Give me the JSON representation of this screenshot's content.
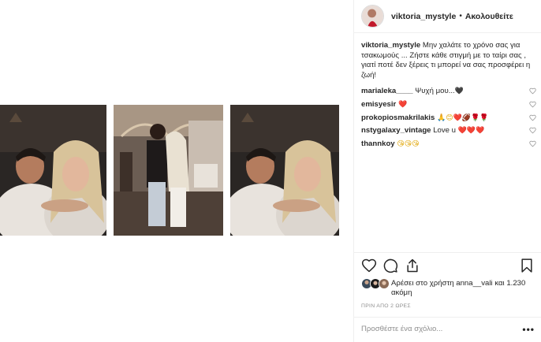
{
  "post": {
    "username": "viktoria_mystyle",
    "separator": "•",
    "follow_label": "Ακολουθείτε"
  },
  "caption": {
    "username": "viktoria_mystyle",
    "text": " Μην χαλάτε το χρόνο σας για τσακωμούς ... Ζήστε κάθε στιγμή με το ταίρι σας , γιατί ποτέ δεν ξέρεις τι μπορεί να σας προσφέρει η ζωή!"
  },
  "comments": [
    {
      "username": "marialeka____",
      "text": " Ψυχή μου...",
      "emoji": [
        "🖤"
      ]
    },
    {
      "username": "emisyesir",
      "text": " ",
      "emoji": [
        "❤️"
      ]
    },
    {
      "username": "prokopiosmakrilakis",
      "text": " ",
      "emoji": [
        "🙏",
        "😊",
        "❤️",
        "🏈",
        "🌹",
        "🌹"
      ]
    },
    {
      "username": "nstygalaxy_vintage",
      "text": " Love u ",
      "emoji": [
        "❤️",
        "❤️",
        "❤️"
      ]
    },
    {
      "username": "thannkoy",
      "text": " ",
      "emoji": [
        "😘",
        "😘",
        "😘"
      ]
    }
  ],
  "icons": {
    "like": "heart-outline-icon",
    "comment": "speech-bubble-icon",
    "share": "share-icon",
    "save": "bookmark-icon",
    "comment_like": "small-heart-icon",
    "more": "more-options-icon"
  },
  "likes": {
    "text": "Αρέσει στο χρήστη anna__vali και 1.230 ακόμη"
  },
  "timestamp": "ΠΡΙΝ ΑΠΟ 2 ΩΡΕΣ",
  "add_comment": {
    "placeholder": "Προσθέστε ένα σχόλιο...",
    "more_label": "•••"
  },
  "colors": {
    "text": "#262626",
    "muted": "#8e8e8e",
    "divider": "#efefef",
    "heart_red": "#e0102a"
  }
}
